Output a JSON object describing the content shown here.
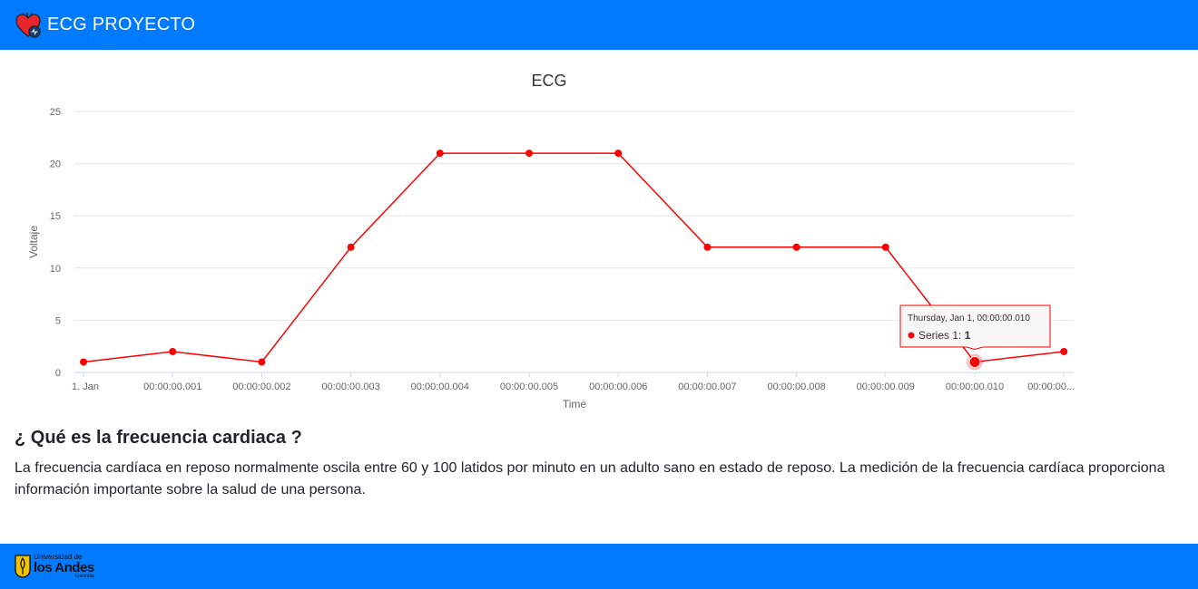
{
  "navbar": {
    "title": "ECG PROYECTO",
    "logo_icon": "heart-icon"
  },
  "chart_data": {
    "type": "line",
    "title": "ECG",
    "xlabel": "Time",
    "ylabel": "Voltaje",
    "ylim": [
      0,
      25
    ],
    "y_ticks": [
      "0",
      "5",
      "10",
      "15",
      "20",
      "25"
    ],
    "categories": [
      "1. Jan",
      "00:00:00.001",
      "00:00:00.002",
      "00:00:00.003",
      "00:00:00.004",
      "00:00:00.005",
      "00:00:00.006",
      "00:00:00.007",
      "00:00:00.008",
      "00:00:00.009",
      "00:00:00.010",
      "00:00:00..."
    ],
    "series": [
      {
        "name": "Series 1",
        "color": "#ff0000",
        "values": [
          1,
          2,
          1,
          12,
          21,
          21,
          21,
          12,
          12,
          12,
          1,
          2
        ]
      }
    ],
    "grid": true,
    "legend": "none",
    "tooltip": {
      "index": 10,
      "header": "Thursday, Jan 1, 00:00:00.010",
      "series_label": "Series 1",
      "value": "1"
    }
  },
  "content": {
    "heading": "¿ Qué es la frecuencia cardiaca ?",
    "paragraph": "La frecuencia cardíaca en reposo normalmente oscila entre 60 y 100 latidos por minuto en un adulto sano en estado de reposo. La medición de la frecuencia cardíaca proporciona información importante sobre la salud de una persona."
  },
  "footer": {
    "logo_line1": "Universidad de",
    "logo_line2": "los Andes",
    "logo_line3": "Colombia",
    "logo_icon": "university-crest-icon"
  },
  "colors": {
    "primary": "#007bff",
    "series": "#ff0000"
  }
}
